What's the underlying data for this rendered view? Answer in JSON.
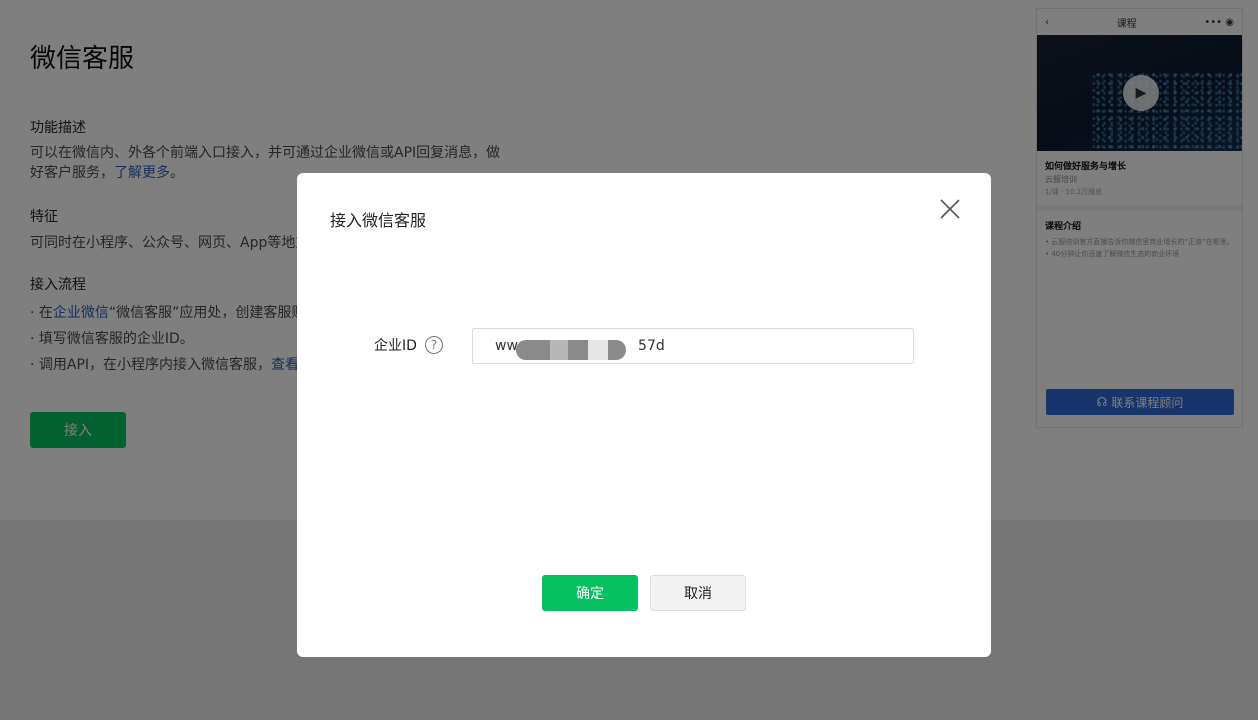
{
  "page": {
    "title": "微信客服",
    "feature_desc": {
      "heading": "功能描述",
      "text": "可以在微信内、外各个前端入口接入，并可通过企业微信或API回复消息，做好客户服务，",
      "link": "了解更多",
      "suffix": "。"
    },
    "features": {
      "heading": "特征",
      "text": "可同时在小程序、公众号、网页、App等地方"
    },
    "process": {
      "heading": "接入流程",
      "step1_prefix": "· 在",
      "step1_link": "企业微信",
      "step1_rest": "“微信客服”应用处，创建客服账",
      "step2": "· 填写微信客服的企业ID。",
      "step3_prefix": "· 调用API，在小程序内接入微信客服，",
      "step3_link": "查看"
    },
    "access_button": "接入"
  },
  "phone": {
    "nav_title": "课程",
    "course_title": "如何做好服务与增长",
    "course_sub": "云服培训",
    "course_meta": "1/课 · 10.2万播放",
    "intro_title": "课程介绍",
    "intro_lines": [
      "• 云服培训官方直播告诉你微信里商业增长的“正道”在哪里。",
      "• 40分钟让你迅速了解微信生态的商业环境"
    ],
    "cta_label": "联系课程顾问"
  },
  "modal": {
    "title": "接入微信客服",
    "field_label": "企业ID",
    "field_value": "ww                           57d",
    "confirm_label": "确定",
    "cancel_label": "取消"
  },
  "colors": {
    "primary_green": "#07c160",
    "link_blue": "#2d5fb3",
    "cta_blue": "#2f6bd8"
  }
}
